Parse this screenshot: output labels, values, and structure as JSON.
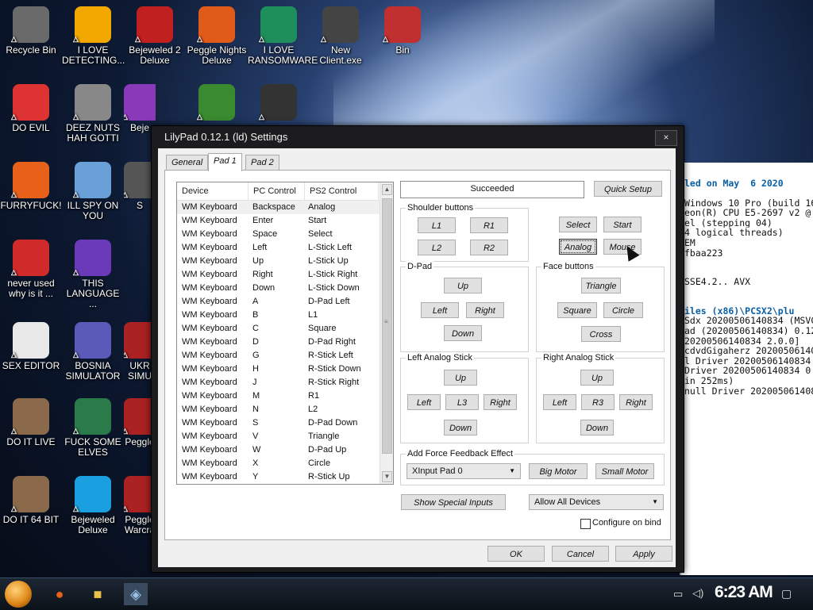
{
  "desktop_icons": [
    {
      "label": "Recycle Bin",
      "icon": "recycle-bin-icon",
      "color": "#6a6a6a"
    },
    {
      "label": "I LOVE DETECTING...",
      "icon": "adobe-de-icon",
      "color": "#f2a800"
    },
    {
      "label": "Bejeweled 2 Deluxe",
      "icon": "bejeweled-2-icon",
      "color": "#c02020"
    },
    {
      "label": "Peggle Nights Deluxe",
      "icon": "peggle-nights-icon",
      "color": "#e05a1a"
    },
    {
      "label": "I LOVE RANSOMWARE",
      "icon": "publisher-icon",
      "color": "#1e8f5a"
    },
    {
      "label": "New Client.exe",
      "icon": "exe-window-icon",
      "color": "#444444"
    },
    {
      "label": "Bin",
      "icon": "bin-icon",
      "color": "#c03030"
    },
    {
      "label": "DO EVIL",
      "icon": "chrome-icon",
      "color": "#dd3333"
    },
    {
      "label": "DEEZ NUTS HAH GOTTI",
      "icon": "copy-windows-icon",
      "color": "#888888"
    },
    {
      "label": "Beje",
      "icon": "bejeweled-icon",
      "color": "#8a3ab8"
    },
    {
      "label": "",
      "icon": "flower-pot-icon",
      "color": "#3a8a30"
    },
    {
      "label": "",
      "icon": "sarcophagus-icon",
      "color": "#333333"
    },
    {
      "label": "FURRYFUCK!",
      "icon": "firefox-icon",
      "color": "#e8611a"
    },
    {
      "label": "ILL SPY ON YOU",
      "icon": "network-spy-icon",
      "color": "#6aa0d8"
    },
    {
      "label": "S",
      "icon": "partial-icon",
      "color": "#555555"
    },
    {
      "label": "never used why is it ...",
      "icon": "devcpp-icon",
      "color": "#d02a2a"
    },
    {
      "label": "THIS LANGUAGE ...",
      "icon": "go-icon",
      "color": "#6a3ab8"
    },
    {
      "label": "SEX EDITOR",
      "icon": "hxd-icon",
      "color": "#e8e8e8"
    },
    {
      "label": "BOSNIA SIMULATOR",
      "icon": "mine-icon",
      "color": "#5a5ab8"
    },
    {
      "label": "UKR SIMU",
      "icon": "partial-icon",
      "color": "#aa2222"
    },
    {
      "label": "DO IT LIVE",
      "icon": "portrait-icon",
      "color": "#8a6a4a"
    },
    {
      "label": "FUCK SOME ELVES",
      "icon": "santa-icon",
      "color": "#2a7a4a"
    },
    {
      "label": "Peggle",
      "icon": "peggle-icon",
      "color": "#aa2222"
    },
    {
      "label": "DO IT 64 BIT",
      "icon": "portrait-64-icon",
      "color": "#8a6a4a"
    },
    {
      "label": "Bejeweled Deluxe",
      "icon": "diamond-icon",
      "color": "#1aa0e0"
    },
    {
      "label": "Peggle Warcra",
      "icon": "peggle-warcraft-icon",
      "color": "#aa2222"
    }
  ],
  "console_lines": [
    {
      "text": "led on May  6 2020",
      "hl": true
    },
    {
      "text": "",
      "hl": false
    },
    {
      "text": "Windows 10 Pro (build 16",
      "hl": false
    },
    {
      "text": "eon(R) CPU E5-2697 v2 @",
      "hl": false
    },
    {
      "text": "el (stepping 04)",
      "hl": false
    },
    {
      "text": "4 logical threads)",
      "hl": false
    },
    {
      "text": "EM",
      "hl": false
    },
    {
      "text": "fbaa223",
      "hl": false
    },
    {
      "text": "",
      "hl": false
    },
    {
      "text": "",
      "hl": false
    },
    {
      "text": "SSE4.2.. AVX",
      "hl": false
    },
    {
      "text": "",
      "hl": false
    },
    {
      "text": "",
      "hl": false
    },
    {
      "text": "iles (x86)\\PCSX2\\plu",
      "hl": true
    },
    {
      "text": "Sdx 20200506140834 (MSVC",
      "hl": false
    },
    {
      "text": "ad (20200506140834) 0.12",
      "hl": false
    },
    {
      "text": "20200506140834 2.0.0]",
      "hl": false
    },
    {
      "text": "cdvdGigaherz 20200506140",
      "hl": false
    },
    {
      "text": "l Driver 20200506140834",
      "hl": false
    },
    {
      "text": "Driver 20200506140834 0",
      "hl": false
    },
    {
      "text": "in 252ms)",
      "hl": false
    },
    {
      "text": "null Driver 202005061408",
      "hl": false
    }
  ],
  "dialog": {
    "title": "LilyPad 0.12.1 (ld) Settings",
    "close": "×",
    "tabs": [
      "General",
      "Pad 1",
      "Pad 2"
    ],
    "list": {
      "headers": [
        "Device",
        "PC Control",
        "PS2 Control"
      ],
      "rows": [
        [
          "WM Keyboard",
          "Backspace",
          "Analog"
        ],
        [
          "WM Keyboard",
          "Enter",
          "Start"
        ],
        [
          "WM Keyboard",
          "Space",
          "Select"
        ],
        [
          "WM Keyboard",
          "Left",
          "L-Stick Left"
        ],
        [
          "WM Keyboard",
          "Up",
          "L-Stick Up"
        ],
        [
          "WM Keyboard",
          "Right",
          "L-Stick Right"
        ],
        [
          "WM Keyboard",
          "Down",
          "L-Stick Down"
        ],
        [
          "WM Keyboard",
          "A",
          "D-Pad Left"
        ],
        [
          "WM Keyboard",
          "B",
          "L1"
        ],
        [
          "WM Keyboard",
          "C",
          "Square"
        ],
        [
          "WM Keyboard",
          "D",
          "D-Pad Right"
        ],
        [
          "WM Keyboard",
          "G",
          "R-Stick Left"
        ],
        [
          "WM Keyboard",
          "H",
          "R-Stick Down"
        ],
        [
          "WM Keyboard",
          "J",
          "R-Stick Right"
        ],
        [
          "WM Keyboard",
          "M",
          "R1"
        ],
        [
          "WM Keyboard",
          "N",
          "L2"
        ],
        [
          "WM Keyboard",
          "S",
          "D-Pad Down"
        ],
        [
          "WM Keyboard",
          "V",
          "Triangle"
        ],
        [
          "WM Keyboard",
          "W",
          "D-Pad Up"
        ],
        [
          "WM Keyboard",
          "X",
          "Circle"
        ],
        [
          "WM Keyboard",
          "Y",
          "R-Stick Up"
        ]
      ],
      "scroll_up": "▲",
      "scroll_down": "▼"
    },
    "status": "Succeeded",
    "quick_setup": "Quick Setup",
    "shoulder": {
      "label": "Shoulder buttons",
      "l1": "L1",
      "r1": "R1",
      "l2": "L2",
      "r2": "R2"
    },
    "misc": {
      "select": "Select",
      "start": "Start",
      "analog": "Analog",
      "mouse": "Mouse"
    },
    "dpad": {
      "label": "D-Pad",
      "up": "Up",
      "left": "Left",
      "right": "Right",
      "down": "Down"
    },
    "face": {
      "label": "Face buttons",
      "triangle": "Triangle",
      "square": "Square",
      "circle": "Circle",
      "cross": "Cross"
    },
    "left_stick": {
      "label": "Left Analog Stick",
      "up": "Up",
      "left": "Left",
      "l3": "L3",
      "right": "Right",
      "down": "Down"
    },
    "right_stick": {
      "label": "Right Analog Stick",
      "up": "Up",
      "left": "Left",
      "r3": "R3",
      "right": "Right",
      "down": "Down"
    },
    "force_feedback": {
      "label": "Add Force Feedback Effect",
      "device": "XInput Pad 0",
      "big_motor": "Big Motor",
      "small_motor": "Small Motor"
    },
    "show_special": "Show Special Inputs",
    "allow_devices": "Allow All Devices",
    "configure_on_bind": "Configure on bind",
    "ok": "OK",
    "cancel": "Cancel",
    "apply": "Apply"
  },
  "taskbar": {
    "clock": "6:23 AM",
    "start_color": "#e08a1a"
  }
}
